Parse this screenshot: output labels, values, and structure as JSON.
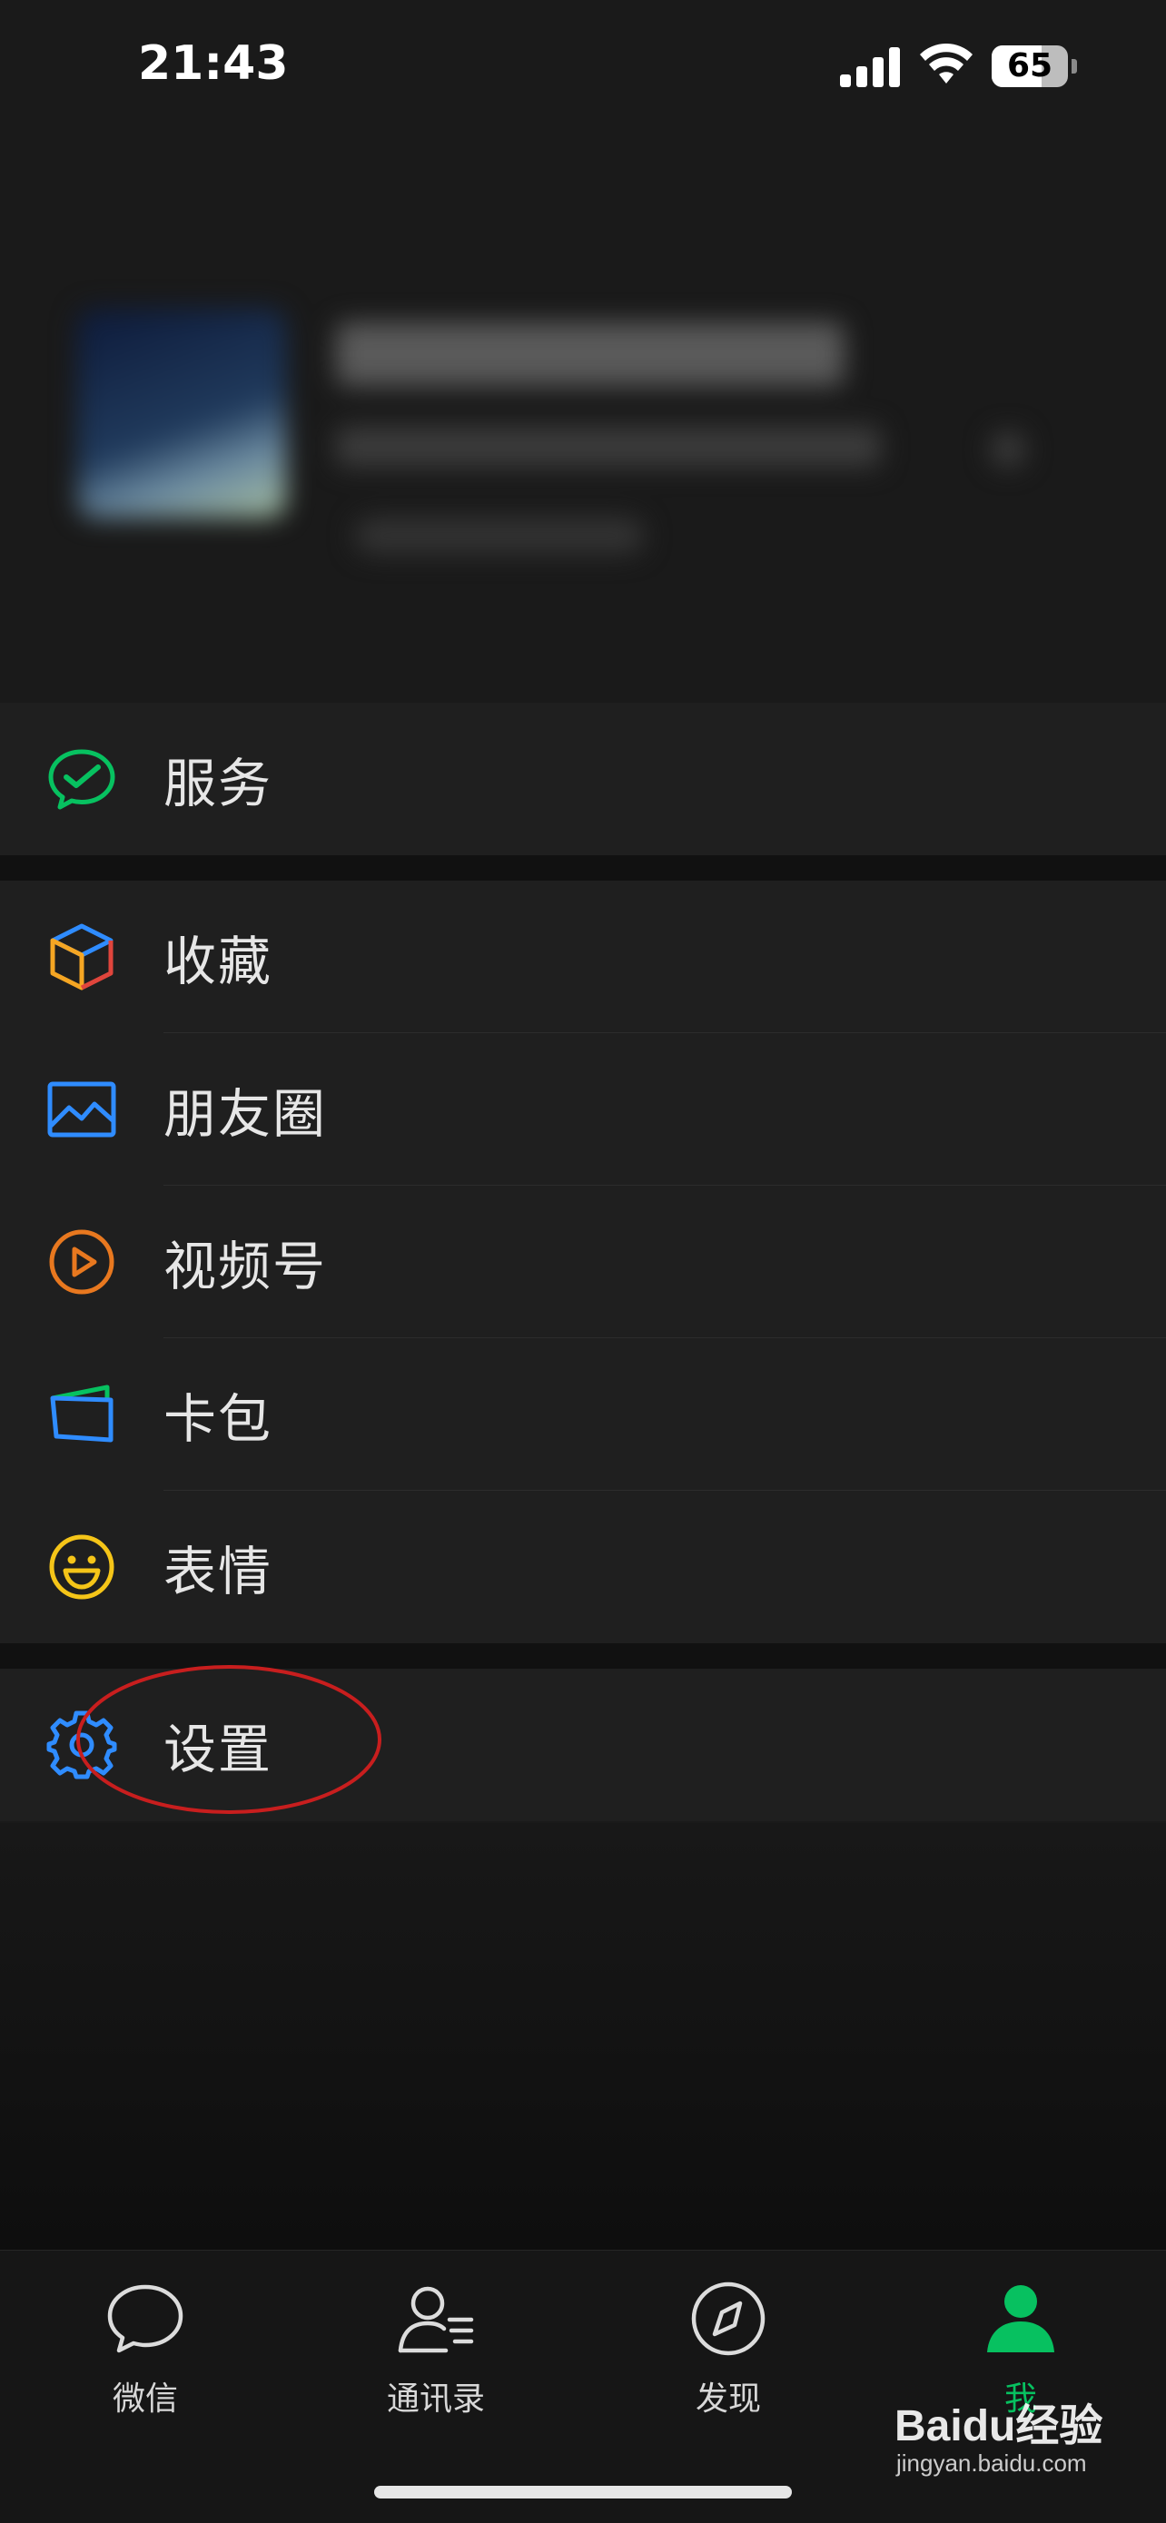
{
  "status_bar": {
    "time": "21:43",
    "battery": "65",
    "battery_level": 0.65
  },
  "menu": {
    "group1": [
      {
        "label": "服务",
        "icon": "wechat-pay-icon",
        "color": "#07c160"
      }
    ],
    "group2": [
      {
        "label": "收藏",
        "icon": "favorites-cube-icon",
        "color": "#2f8cff"
      },
      {
        "label": "朋友圈",
        "icon": "moments-photo-icon",
        "color": "#2f8cff"
      },
      {
        "label": "视频号",
        "icon": "channels-play-icon",
        "color": "#e8781f"
      },
      {
        "label": "卡包",
        "icon": "card-wallet-icon",
        "color": "#2f8cff"
      },
      {
        "label": "表情",
        "icon": "sticker-smile-icon",
        "color": "#f5c518"
      }
    ],
    "group3": [
      {
        "label": "设置",
        "icon": "settings-gear-icon",
        "color": "#2f8cff"
      }
    ]
  },
  "annotation": {
    "color": "#c81e1e"
  },
  "tabbar": {
    "active_color": "#07c160",
    "tabs": [
      {
        "label": "微信",
        "icon": "chat-bubble-icon",
        "active": false
      },
      {
        "label": "通讯录",
        "icon": "contacts-icon",
        "active": false
      },
      {
        "label": "发现",
        "icon": "compass-icon",
        "active": false
      },
      {
        "label": "我",
        "icon": "person-icon",
        "active": true
      }
    ]
  },
  "watermark": {
    "logo": "Baidu经验",
    "url": "jingyan.baidu.com"
  }
}
